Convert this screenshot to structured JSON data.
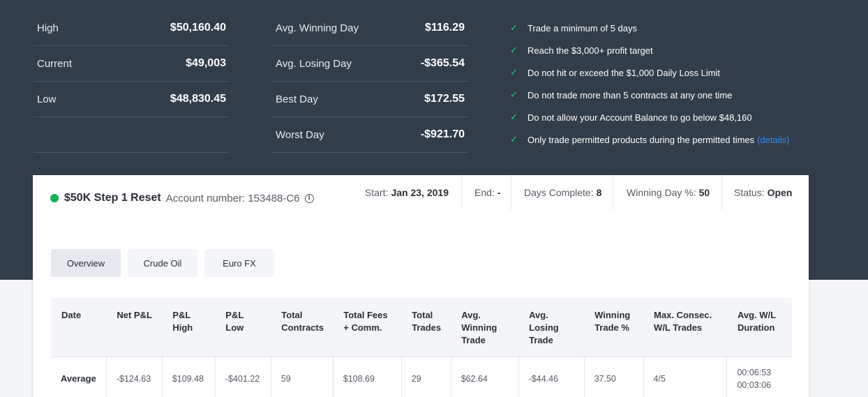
{
  "balance": [
    {
      "label": "High",
      "value": "$50,160.40"
    },
    {
      "label": "Current",
      "value": "$49,003"
    },
    {
      "label": "Low",
      "value": "$48,830.45"
    }
  ],
  "days": [
    {
      "label": "Avg. Winning Day",
      "value": "$116.29"
    },
    {
      "label": "Avg. Losing Day",
      "value": "-$365.54"
    },
    {
      "label": "Best Day",
      "value": "$172.55"
    },
    {
      "label": "Worst Day",
      "value": "-$921.70"
    }
  ],
  "rules": [
    "Trade a minimum of 5 days",
    "Reach the $3,000+ profit target",
    "Do not hit or exceed the $1,000 Daily Loss Limit",
    "Do not trade more than 5 contracts at any one time",
    "Do not allow your Account Balance to go below $48,160",
    "Only trade permitted products during the permitted times"
  ],
  "rules_link": "(details)",
  "check_glyph": "✓",
  "account": {
    "name": "$50K Step 1 Reset",
    "number_label": "Account number: 153488-C6",
    "info_glyph": "i",
    "start_label": "Start:",
    "start_value": "Jan 23, 2019",
    "end_label": "End:",
    "end_value": "-",
    "days_label": "Days Complete:",
    "days_value": "8",
    "winpct_label": "Winning Day %:",
    "winpct_value": "50",
    "status_label": "Status:",
    "status_value": "Open",
    "status_color": "#16b053"
  },
  "tabs": [
    "Overview",
    "Crude Oil",
    "Euro FX"
  ],
  "table": {
    "headers": [
      [
        "Date"
      ],
      [
        "Net P&L"
      ],
      [
        "P&L",
        "High"
      ],
      [
        "P&L",
        "Low"
      ],
      [
        "Total",
        "Contracts"
      ],
      [
        "Total Fees",
        "+ Comm."
      ],
      [
        "Total",
        "Trades"
      ],
      [
        "Avg.",
        "Winning",
        "Trade"
      ],
      [
        "Avg.",
        "Losing",
        "Trade"
      ],
      [
        "Winning",
        "Trade %"
      ],
      [
        "Max. Consec.",
        "W/L Trades"
      ],
      [
        "Avg. W/L",
        "Duration"
      ]
    ],
    "row_label": "Average",
    "row": [
      "-$124.63",
      "$109.48",
      "-$401.22",
      "59",
      "$108.69",
      "29",
      "$62.64",
      "-$44.46",
      "37.50",
      "4/5"
    ],
    "duration": [
      "00:06:53",
      "00:03:06"
    ]
  }
}
